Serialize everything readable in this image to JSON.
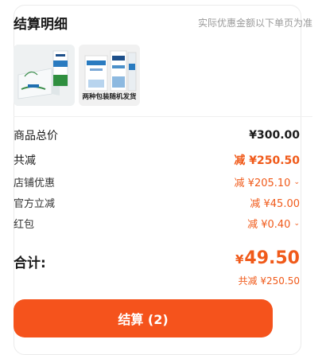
{
  "header": {
    "title": "结算明细",
    "note": "实际优惠金额以下单页为准"
  },
  "products": [
    {
      "icon": "milk-gift-box-icon"
    },
    {
      "icon": "milk-packs-icon",
      "caption": "两种包装随机发货"
    }
  ],
  "summary": {
    "total_price": {
      "label": "商品总价",
      "value": "¥300.00"
    },
    "total_discount": {
      "label": "共减",
      "value": "减 ¥250.50"
    },
    "store_discount": {
      "label": "店铺优惠",
      "value": "减 ¥205.10"
    },
    "platform_discount": {
      "label": "官方立减",
      "value": "减 ¥45.00"
    },
    "red_packet": {
      "label": "红包",
      "value": "减 ¥0.40"
    }
  },
  "total": {
    "label": "合计:",
    "currency": "¥",
    "amount": "49.50",
    "saved": "共减 ¥250.50"
  },
  "checkout": {
    "label": "结算 (2)"
  },
  "colors": {
    "accent": "#f5531c",
    "accent_text": "#f05a1a"
  }
}
